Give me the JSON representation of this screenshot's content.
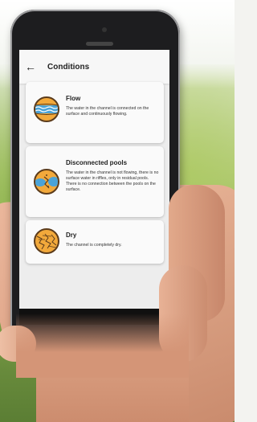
{
  "header": {
    "back_label": "←",
    "title": "Conditions"
  },
  "conditions": [
    {
      "title": "Flow",
      "description": "The water in the channel is connected on the surface and continuously flowing.",
      "icon": "flowing-water-icon"
    },
    {
      "title": "Disconnected pools",
      "description": "The water in the channel is not flowing, there is no surface water in riffles, only in residual pools. There is no connection between the pools on the surface.",
      "icon": "disconnected-pools-icon"
    },
    {
      "title": "Dry",
      "description": "The channel is completely dry.",
      "icon": "dry-riverbed-icon"
    }
  ],
  "colors": {
    "icon_background": "#f2a93b",
    "icon_border": "#5b3b1b",
    "water": "#4aa3d8"
  }
}
